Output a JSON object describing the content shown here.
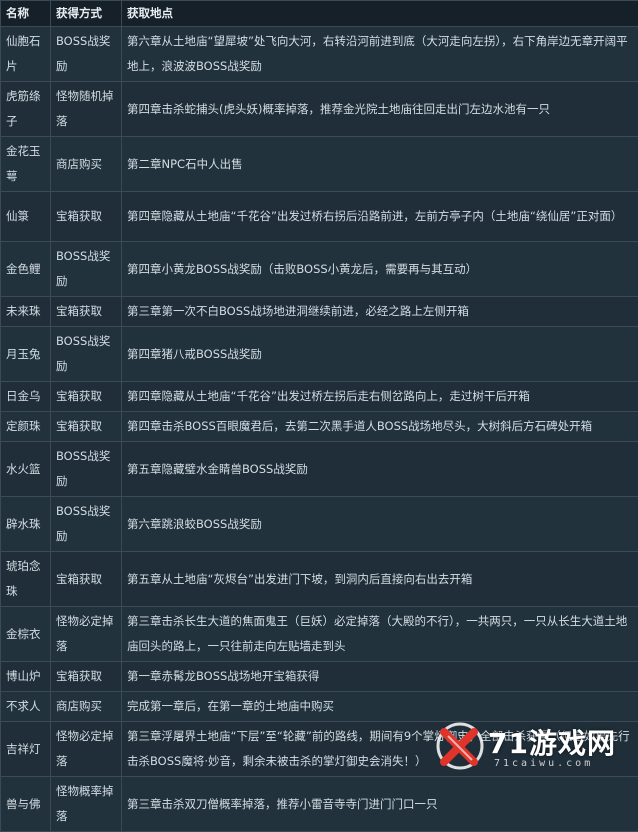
{
  "header": {
    "col_name": "名称",
    "col_method": "获得方式",
    "col_location": "获取地点"
  },
  "rows": [
    {
      "name": "仙胞石片",
      "method": "BOSS战奖励",
      "location": "第六章从土地庙“望犀坡”处飞向大河，右转沿河前进到底（大河走向左拐），右下角岸边无章开阔平地上，浪波波BOSS战奖励"
    },
    {
      "name": "虎筋绦子",
      "method": "怪物随机掉落",
      "location": "第四章击杀蛇捕头(虎头妖)概率掉落，推荐金光院土地庙往回走出门左边水池有一只"
    },
    {
      "name": "金花玉萼",
      "method": "商店购买",
      "location": "第二章NPC石中人出售"
    },
    {
      "name": "仙箓",
      "method": "宝箱获取",
      "location": "第四章隐藏从土地庙“千花谷”出发过桥右拐后沿路前进，左前方亭子内（土地庙“绕仙居”正对面）"
    },
    {
      "name": "金色鲤",
      "method": "BOSS战奖励",
      "location": "第四章小黄龙BOSS战奖励（击败BOSS小黄龙后，需要再与其互动）"
    },
    {
      "name": "未来珠",
      "method": "宝箱获取",
      "location": "第三章第一次不白BOSS战场地进洞继续前进，必经之路上左侧开箱"
    },
    {
      "name": "月玉兔",
      "method": "BOSS战奖励",
      "location": "第四章猪八戒BOSS战奖励"
    },
    {
      "name": "日金乌",
      "method": "宝箱获取",
      "location": "第四章隐藏从土地庙“千花谷”出发过桥左拐后走右侧岔路向上，走过树干后开箱"
    },
    {
      "name": "定颜珠",
      "method": "宝箱获取",
      "location": "第四章击杀BOSS百眼魔君后，去第二次黑手道人BOSS战场地尽头，大树斜后方石碑处开箱"
    },
    {
      "name": "水火篮",
      "method": "BOSS战奖励",
      "location": "第五章隐藏璧水金睛兽BOSS战奖励"
    },
    {
      "name": "辟水珠",
      "method": "BOSS战奖励",
      "location": "第六章跳浪蛟BOSS战奖励"
    },
    {
      "name": "琥珀念珠",
      "method": "宝箱获取",
      "location": "第五章从土地庙“灰烬台”出发进门下坡，到洞内后直接向右出去开箱"
    },
    {
      "name": "金棕衣",
      "method": "怪物必定掉落",
      "location": "第三章击杀长生大道的焦面鬼王（巨妖）必定掉落（大殿的不行），一共两只，一只从长生大道土地庙回头的路上，一只往前走向左贴墙走到头"
    },
    {
      "name": "博山炉",
      "method": "宝箱获取",
      "location": "第一章赤髯龙BOSS战场地开宝箱获得"
    },
    {
      "name": "不求人",
      "method": "商店购买",
      "location": "完成第一章后，在第一章的土地庙中购买"
    },
    {
      "name": "吉祥灯",
      "method": "怪物必定掉落",
      "location": "第三章浮屠界土地庙“下层”至“轮藏”前的路线，期间有9个掌灯御史，全部击杀获得（但是如果先行击杀BOSS魔将·妙音，剩余未被击杀的掌灯御史会消失！）"
    },
    {
      "name": "兽与佛",
      "method": "怪物概率掉落",
      "location": "第三章击杀双刀僧概率掉落，推荐小雷音寺寺门进门门口一只"
    }
  ],
  "watermark": {
    "brand": "71游戏网",
    "domain": "71caiwu.com"
  },
  "colors": {
    "background": "#1e2c36",
    "header_bg": "#162029",
    "border": "#3b4a54",
    "logo_red": "#e0342b"
  }
}
